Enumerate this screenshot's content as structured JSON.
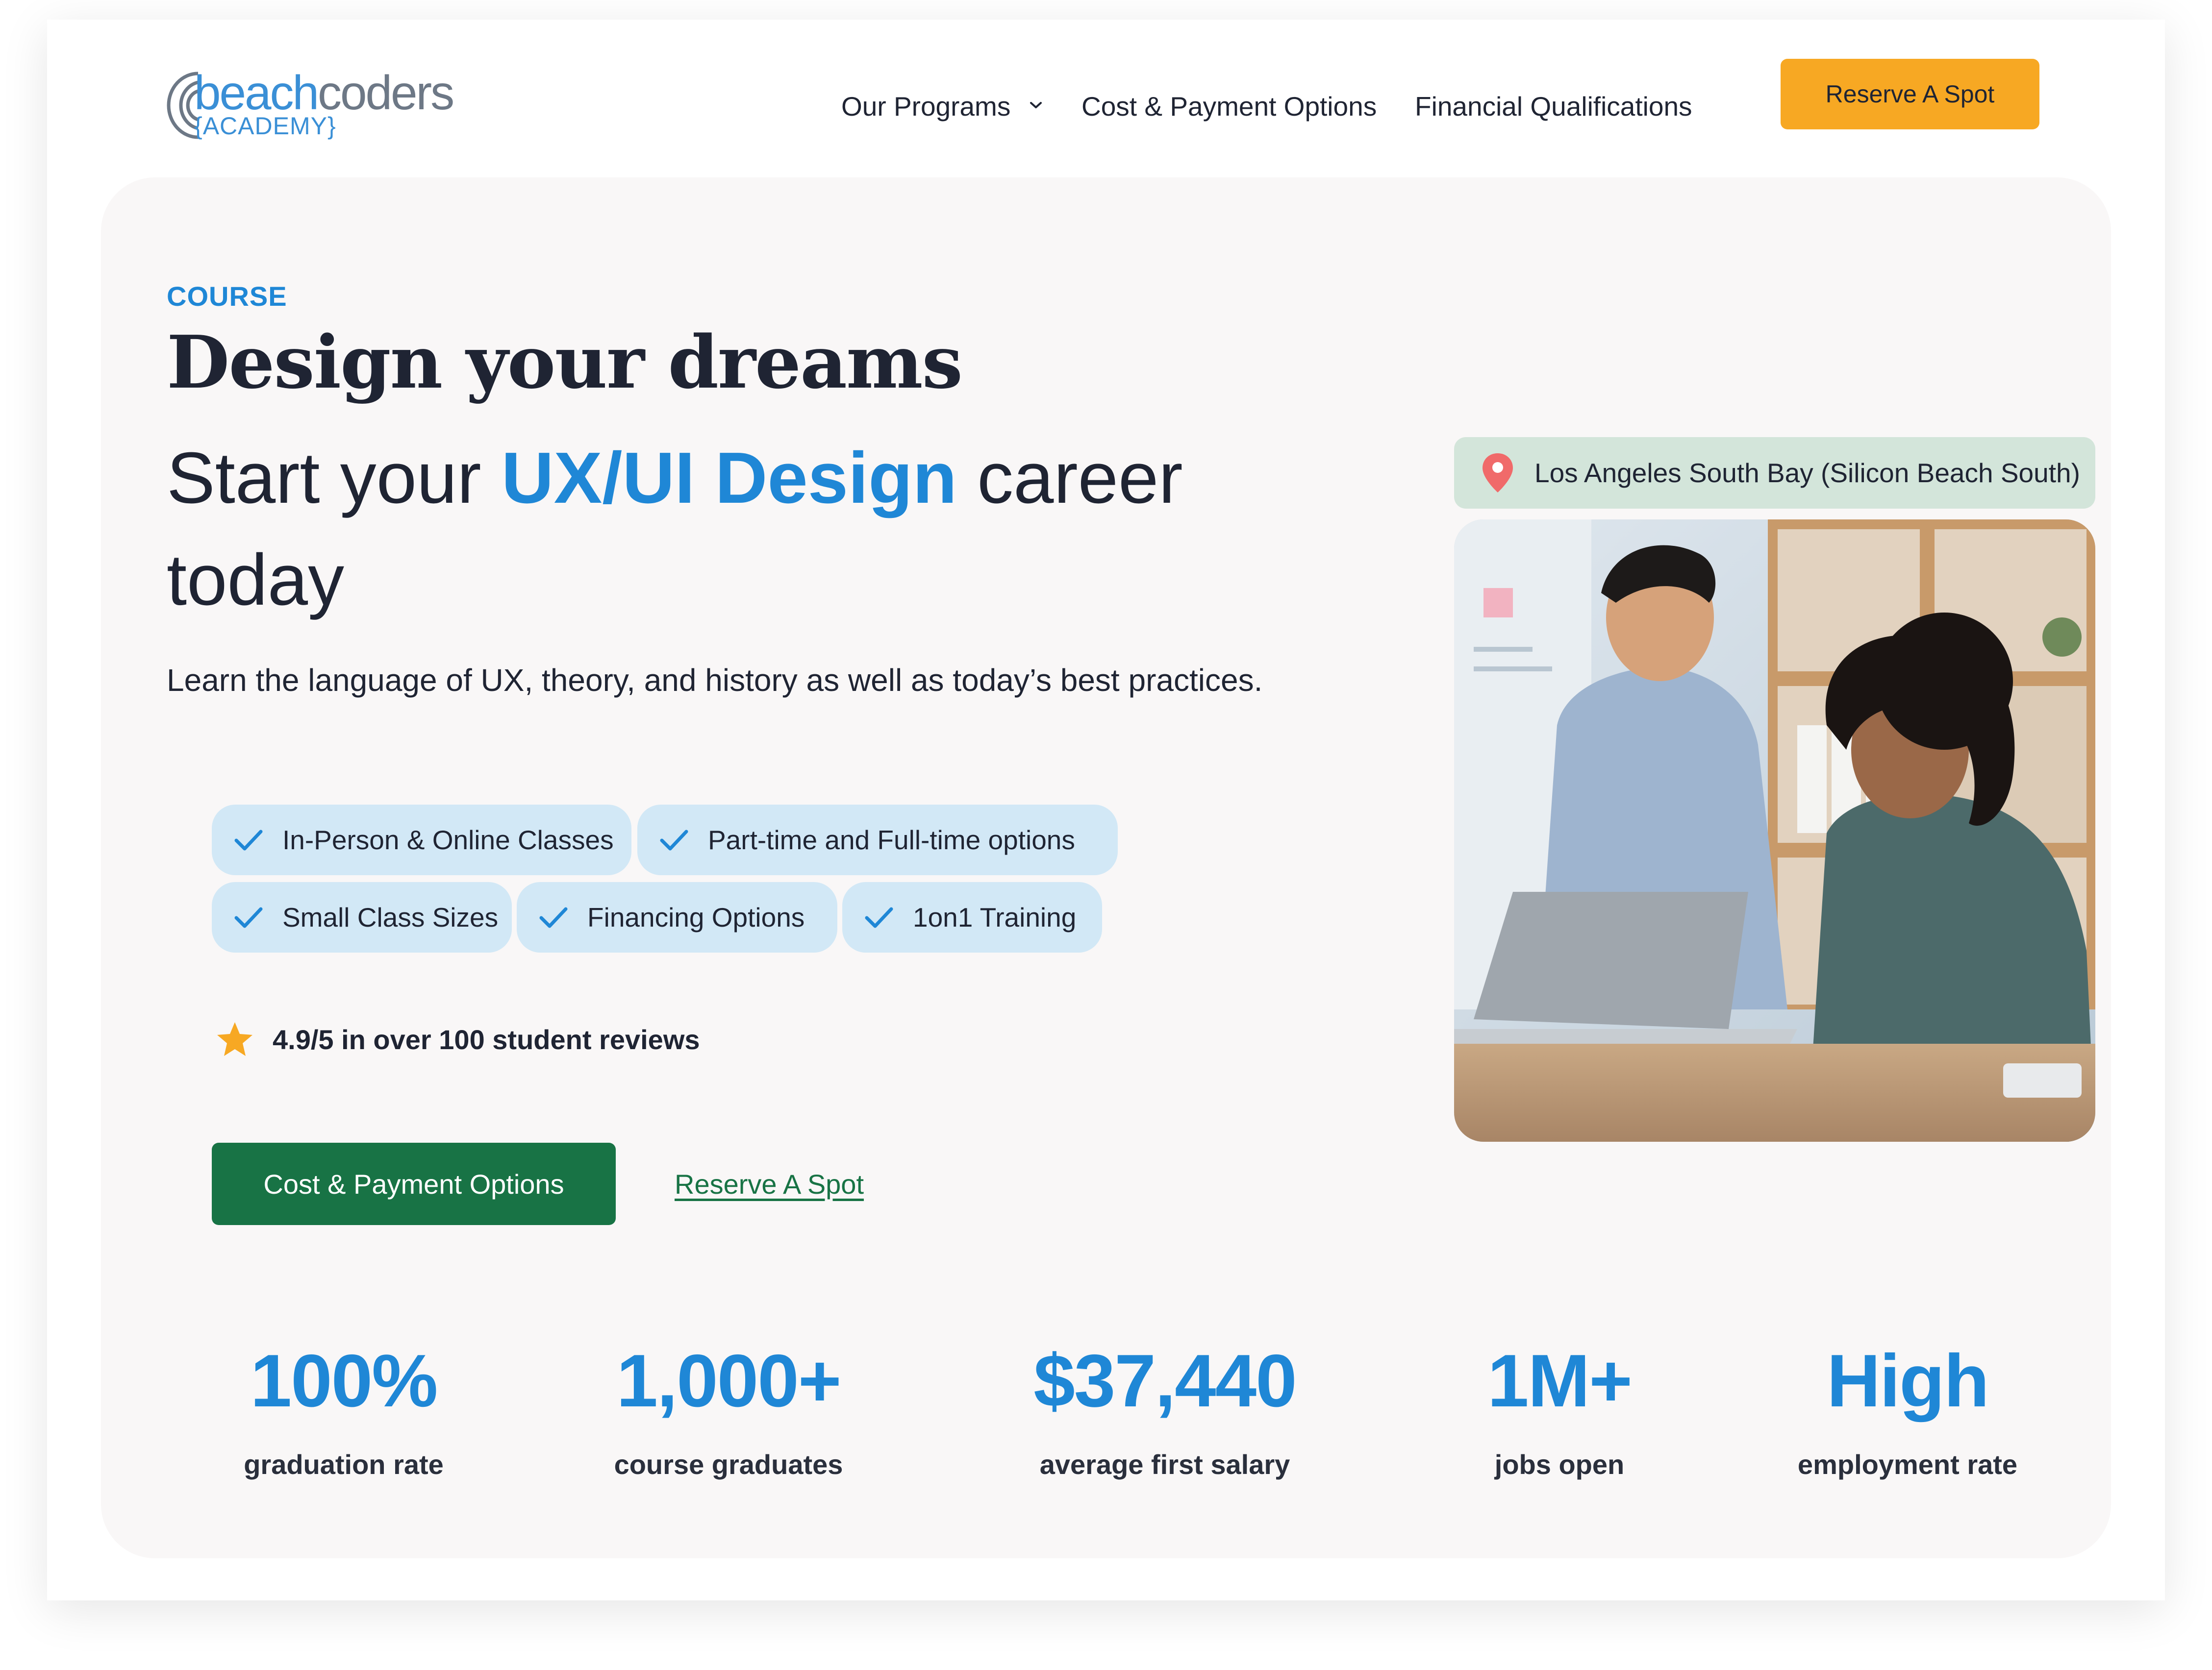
{
  "header": {
    "logo": {
      "brand_part1": "beach",
      "brand_part2": "coders",
      "sub": "{ACADEMY}"
    },
    "nav": {
      "programs_label": "Our Programs",
      "cost_label": "Cost & Payment Options",
      "financial_label": "Financial Qualifications"
    },
    "reserve_label": "Reserve A Spot"
  },
  "hero": {
    "eyebrow": "COURSE",
    "headline": "Design your dreams",
    "subhead_pre": "Start your ",
    "subhead_highlight": "UX/UI Design",
    "subhead_post": " career today",
    "description": "Learn the language of UX, theory, and history as well as today’s best practices.",
    "features": [
      "In-Person & Online Classes",
      "Part-time and Full-time options",
      "Small Class Sizes",
      "Financing Options",
      "1on1 Training"
    ],
    "rating_text": "4.9/5 in over 100 student reviews",
    "primary_button": "Cost & Payment Options",
    "secondary_link": "Reserve A Spot",
    "location": "Los Angeles South Bay (Silicon Beach South)"
  },
  "stats": [
    {
      "value": "100%",
      "label": "graduation rate"
    },
    {
      "value": "1,000+",
      "label": "course graduates"
    },
    {
      "value": "$37,440",
      "label": "average first salary"
    },
    {
      "value": "1M+",
      "label": "jobs open"
    },
    {
      "value": "High",
      "label": "employment rate"
    }
  ],
  "colors": {
    "accent_blue": "#1f87d6",
    "cta_orange": "#f7a823",
    "cta_green": "#187345",
    "chip_bg": "#d2e8f6",
    "location_bg": "#d3e5da",
    "hero_bg": "#f9f7f7"
  },
  "icons": {
    "nav_dropdown": "chevron-down-icon",
    "feature": "check-icon",
    "rating": "star-icon",
    "location": "map-pin-icon"
  }
}
